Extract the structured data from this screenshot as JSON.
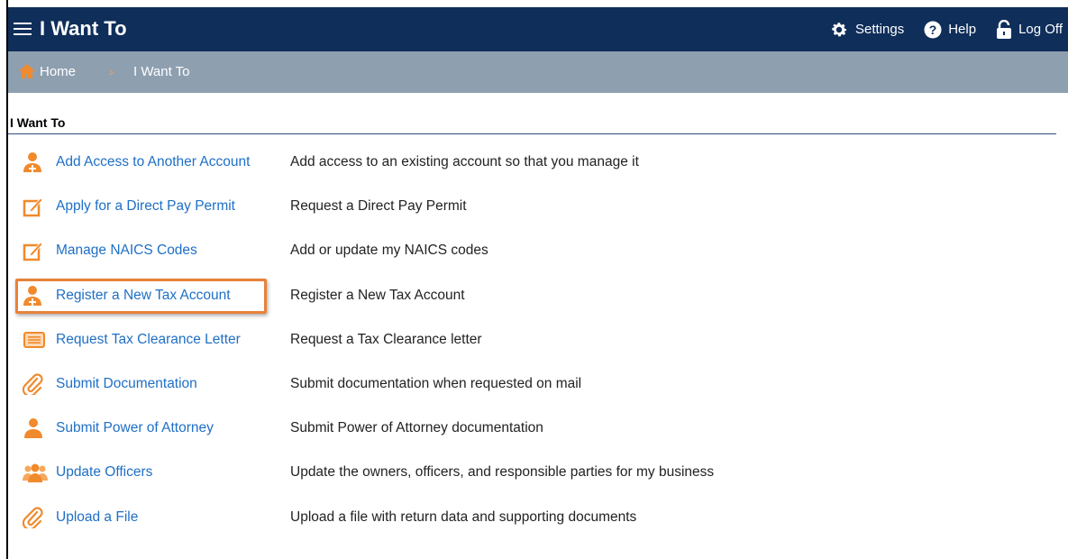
{
  "header": {
    "title": "I Want To",
    "actions": [
      {
        "label": "Settings",
        "icon": "gear-icon"
      },
      {
        "label": "Help",
        "icon": "help-icon"
      },
      {
        "label": "Log Off",
        "icon": "lock-icon"
      }
    ]
  },
  "breadcrumb": {
    "home": "Home",
    "separator": "›",
    "current": "I Want To"
  },
  "section": {
    "title": "I Want To"
  },
  "items": [
    {
      "label": "Add Access to Another Account",
      "description": "Add access to an existing account so that you manage it",
      "icon": "add-person-icon"
    },
    {
      "label": "Apply for a Direct Pay Permit",
      "description": "Request a Direct Pay Permit",
      "icon": "edit-icon"
    },
    {
      "label": "Manage NAICS Codes",
      "description": "Add or update my NAICS codes",
      "icon": "edit-icon"
    },
    {
      "label": "Register a New Tax Account",
      "description": "Register a New Tax Account",
      "icon": "add-person-icon",
      "highlighted": true
    },
    {
      "label": "Request Tax Clearance Letter",
      "description": "Request a Tax Clearance letter",
      "icon": "letter-icon"
    },
    {
      "label": "Submit Documentation",
      "description": "Submit documentation when requested on mail",
      "icon": "paperclip-icon"
    },
    {
      "label": "Submit Power of Attorney",
      "description": "Submit Power of Attorney documentation",
      "icon": "person-icon"
    },
    {
      "label": "Update Officers",
      "description": "Update the owners, officers, and responsible parties for my business",
      "icon": "group-icon"
    },
    {
      "label": "Upload a File",
      "description": "Upload a file with return data and supporting documents",
      "icon": "paperclip-icon"
    }
  ],
  "colors": {
    "header_bg": "#0f2e5a",
    "breadcrumb_bg": "#8e9fb0",
    "link": "#1f6fc5",
    "icon_orange": "#f08a2c",
    "highlight": "#e8823a"
  }
}
